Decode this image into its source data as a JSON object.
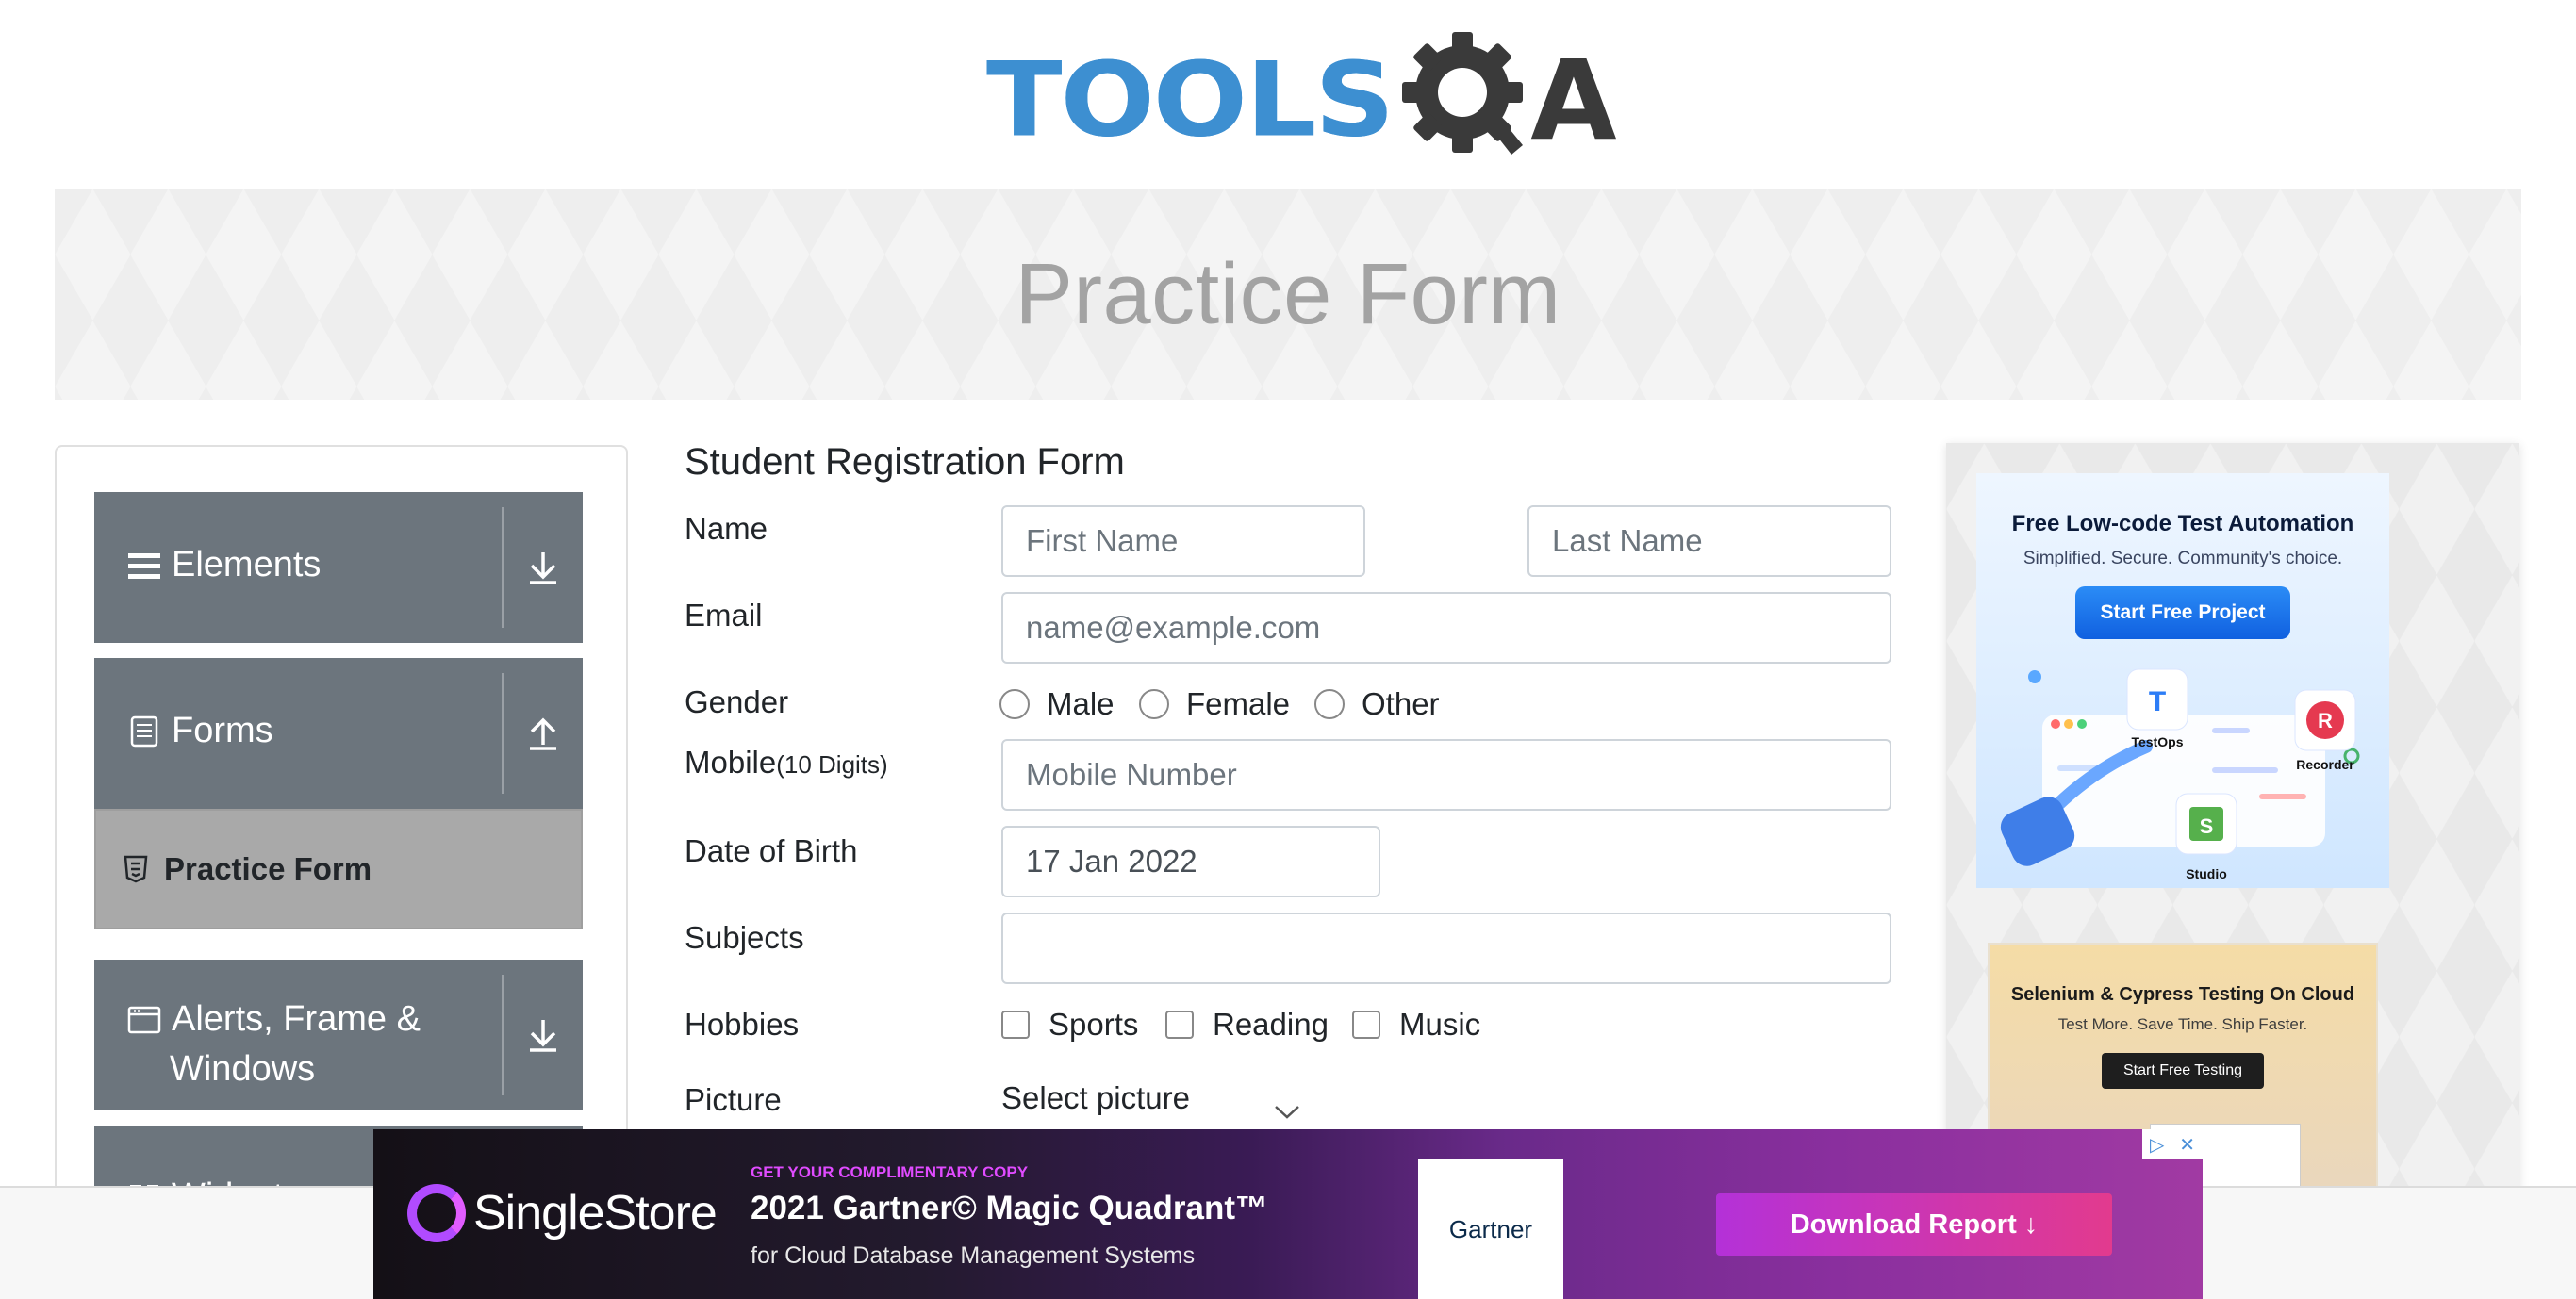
{
  "logo": {
    "text_left": "TOOLS",
    "text_right": "A"
  },
  "banner": {
    "title": "Practice Form"
  },
  "sidebar": {
    "groups": [
      {
        "label": "Elements",
        "icon": "hamburger-icon",
        "toggle": "chevron-down-icon"
      },
      {
        "label": "Forms",
        "icon": "document-icon",
        "toggle": "chevron-up-icon"
      },
      {
        "label_line1": "Alerts, Frame &",
        "label_line2": "Windows",
        "icon": "window-icon",
        "toggle": "chevron-down-icon"
      },
      {
        "label": "Widgets",
        "icon": "widgets-icon"
      }
    ],
    "active_item": {
      "label": "Practice Form",
      "icon": "html5-icon"
    }
  },
  "form": {
    "title": "Student Registration Form",
    "name_label": "Name",
    "first_name_placeholder": "First Name",
    "last_name_placeholder": "Last Name",
    "email_label": "Email",
    "email_placeholder": "name@example.com",
    "gender_label": "Gender",
    "gender_options": [
      "Male",
      "Female",
      "Other"
    ],
    "mobile_label": "Mobile",
    "mobile_hint": "(10 Digits)",
    "mobile_placeholder": "Mobile Number",
    "dob_label": "Date of Birth",
    "dob_value": "17 Jan 2022",
    "subjects_label": "Subjects",
    "subjects_value": "",
    "hobbies_label": "Hobbies",
    "hobby_options": [
      "Sports",
      "Reading",
      "Music"
    ],
    "picture_label": "Picture",
    "picture_button": "Select picture"
  },
  "ads": {
    "right_top": {
      "title": "Free Low-code Test Automation",
      "subtitle": "Simplified. Secure. Community's choice.",
      "button": "Start Free Project",
      "apps": [
        "TestOps",
        "Recorder",
        "Studio"
      ]
    },
    "right_bottom": {
      "title": "Selenium & Cypress Testing On Cloud",
      "subtitle": "Test More. Save Time. Ship Faster.",
      "button": "Start Free Testing"
    },
    "bottom": {
      "brand": "SingleStore",
      "kicker": "GET YOUR COMPLIMENTARY COPY",
      "headline": "2021 Gartner© Magic Quadrant™",
      "subline": "for Cloud Database Management Systems",
      "partner": "Gartner",
      "cta": "Download Report ↓"
    }
  },
  "colors": {
    "sidebar_group": "#6c757d",
    "sidebar_active": "#a9a9a9",
    "logo_blue": "#3d8fd1",
    "logo_dark": "#3a3a3a",
    "banner_title": "#a3a3a3"
  }
}
